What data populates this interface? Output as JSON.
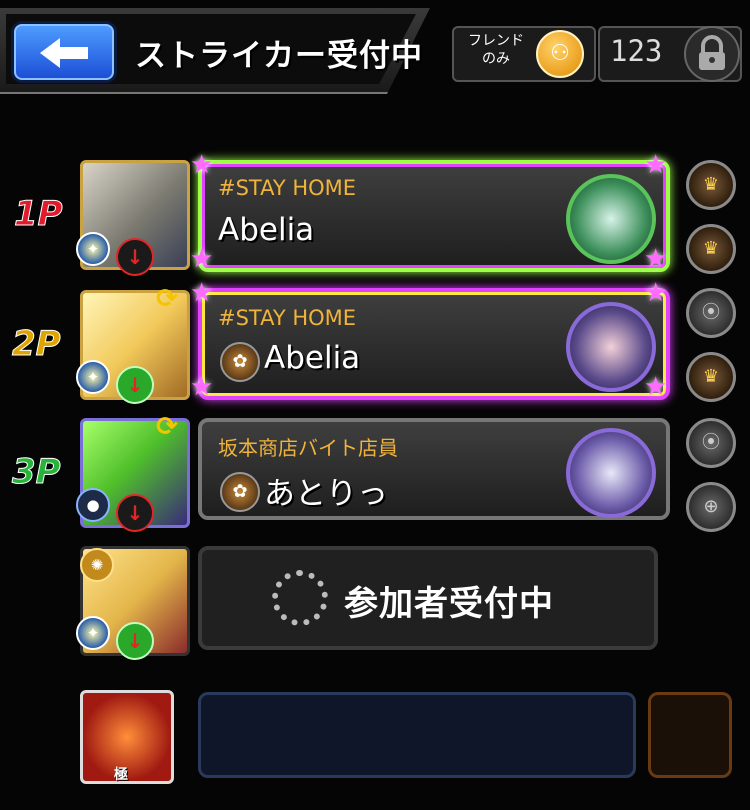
{
  "header": {
    "title": "ストライカー受付中",
    "friend_only_label": "フレンド のみ",
    "room_number": "123"
  },
  "slots": [
    {
      "player": "1P",
      "tag": "#STAY HOME",
      "name": "Abelia"
    },
    {
      "player": "2P",
      "tag": "#STAY HOME",
      "name": "Abelia"
    },
    {
      "player": "3P",
      "tag": "坂本商店バイト店員",
      "name": "あとりっ"
    },
    {
      "status": "参加者受付中"
    }
  ],
  "boss_badge": "極",
  "colors": {
    "p1": "#e11b2b",
    "p2": "#e0a400",
    "p3": "#28b43a",
    "accent_gold": "#f0b43a",
    "back_button": "#2f6ff0"
  }
}
